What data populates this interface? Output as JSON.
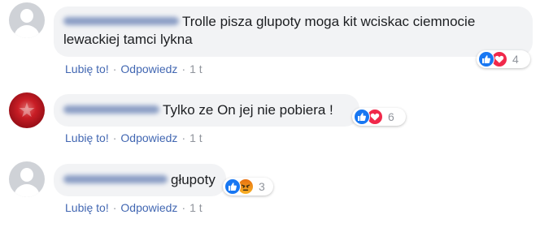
{
  "comments": [
    {
      "author": "",
      "text": "Trolle pisza glupoty moga kit wciskac ciemnocie lewackiej tamci lykna",
      "reactions": {
        "icons": [
          "like-icon",
          "love-icon"
        ],
        "count": "4"
      },
      "actions": {
        "like": "Lubię to!",
        "reply": "Odpowiedz",
        "separator": "·",
        "time": "1 t"
      }
    },
    {
      "author": "",
      "text": "Tylko ze On jej nie pobiera !",
      "reactions": {
        "icons": [
          "like-icon",
          "love-icon"
        ],
        "count": "6"
      },
      "actions": {
        "like": "Lubię to!",
        "reply": "Odpowiedz",
        "separator": "·",
        "time": "1 t"
      }
    },
    {
      "author": "",
      "text": "głupoty",
      "reactions": {
        "icons": [
          "like-icon",
          "angry-icon"
        ],
        "count": "3"
      },
      "actions": {
        "like": "Lubię to!",
        "reply": "Odpowiedz",
        "separator": "·",
        "time": "1 t"
      }
    }
  ],
  "colors": {
    "link": "#4267b2",
    "meta": "#90949c",
    "bubble": "#f2f3f5",
    "like": "#1877f2",
    "love": "#f0284a",
    "angry": "#e9710f"
  }
}
